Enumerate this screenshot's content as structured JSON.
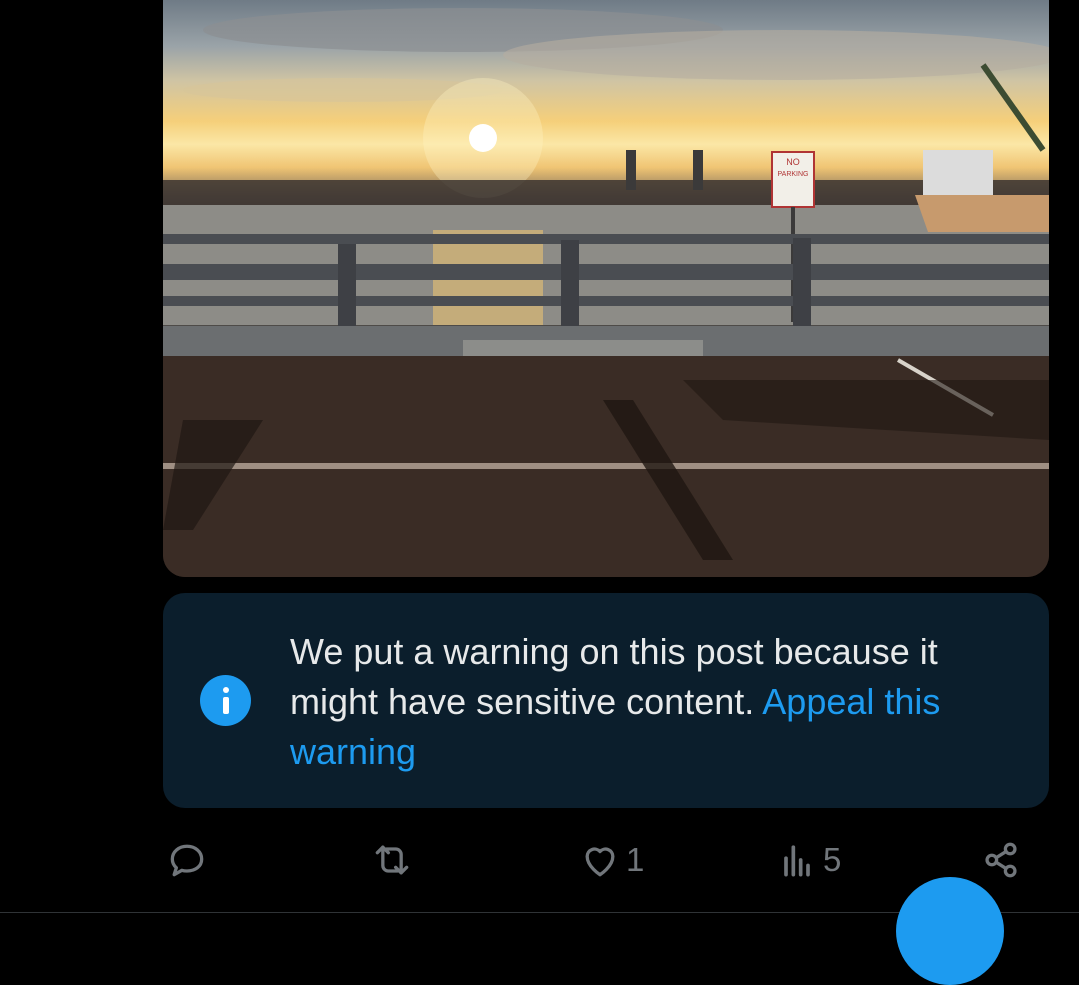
{
  "post": {
    "media": {
      "alt": "Sunset over harbor from bridge with no parking sign",
      "sign_lines": [
        "NO",
        "PARKING"
      ]
    },
    "warning": {
      "text": "We put a warning on this post because it might have sensitive content.",
      "appeal_link": "Appeal this warning"
    },
    "actions": {
      "reply": {
        "icon": "reply-icon",
        "count": ""
      },
      "repost": {
        "icon": "repost-icon",
        "count": ""
      },
      "like": {
        "icon": "heart-icon",
        "count": "1"
      },
      "views": {
        "icon": "views-icon",
        "count": "5"
      },
      "share": {
        "icon": "share-icon"
      }
    }
  },
  "colors": {
    "accent": "#1d9bf0",
    "warning_bg": "#0b1e2c",
    "icon_gray": "#71767b"
  }
}
